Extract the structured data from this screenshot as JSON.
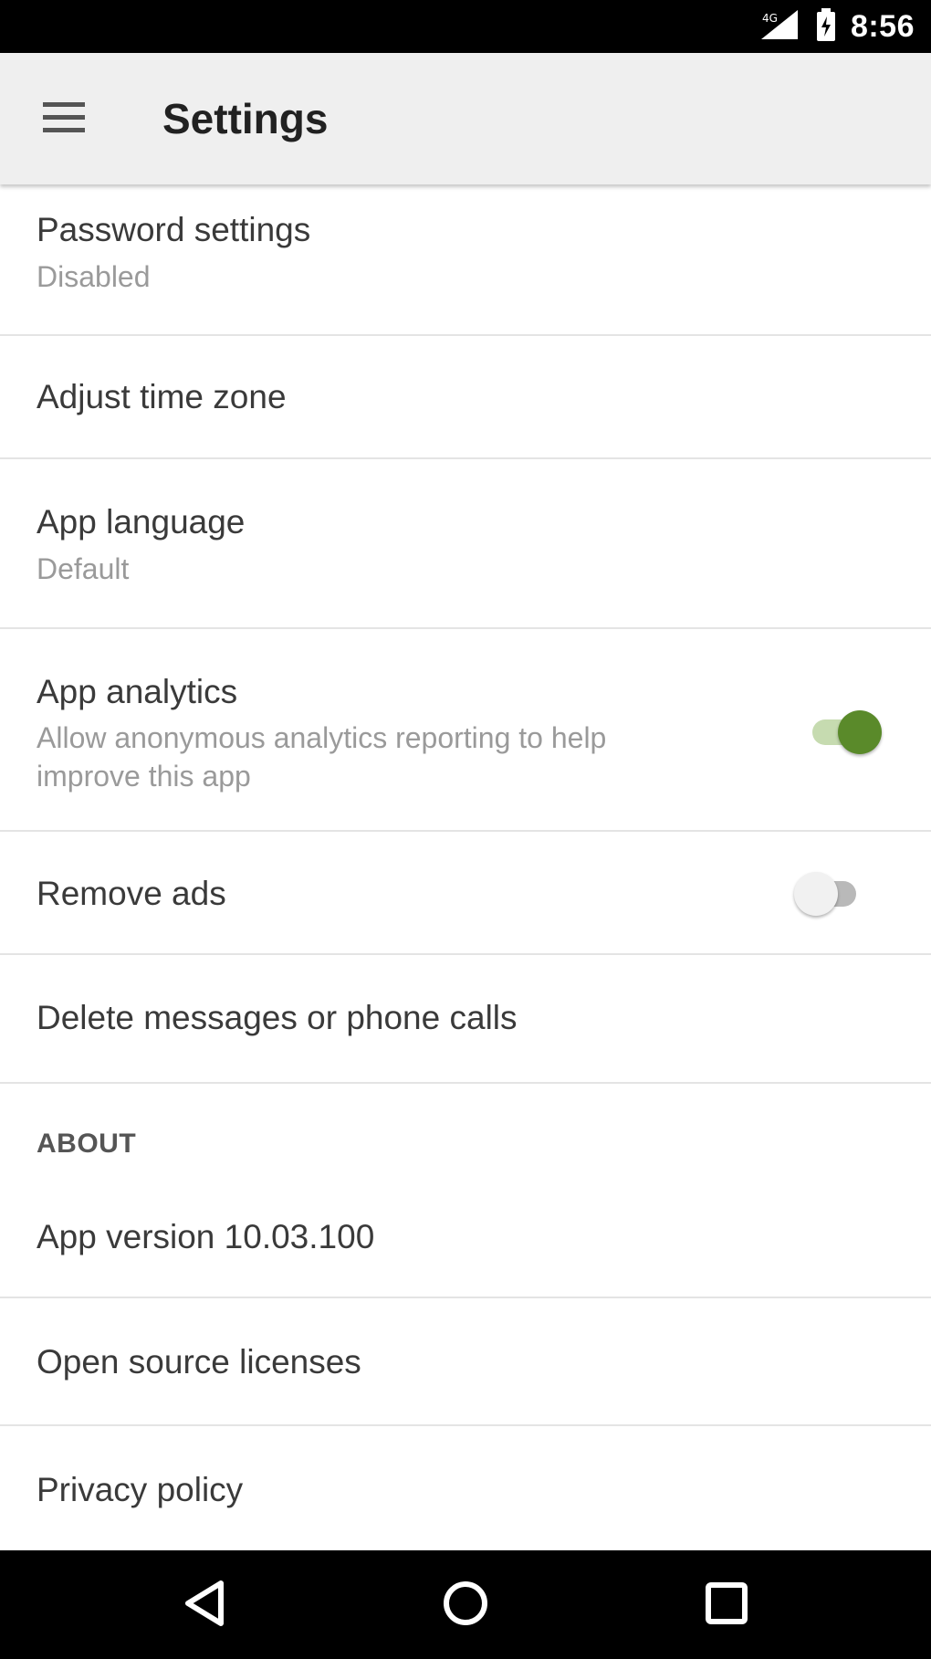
{
  "status_bar": {
    "time": "8:56",
    "icons": [
      "signal-icon",
      "battery-icon"
    ]
  },
  "app_bar": {
    "title": "Settings",
    "menu_icon": "hamburger-menu-icon"
  },
  "settings": {
    "password": {
      "title": "Password settings",
      "subtitle": "Disabled"
    },
    "time_zone": {
      "title": "Adjust time zone"
    },
    "language": {
      "title": "App language",
      "subtitle": "Default"
    },
    "analytics": {
      "title": "App analytics",
      "subtitle_line1": "Allow anonymous analytics reporting to help",
      "subtitle_line2": "improve this app",
      "enabled": true
    },
    "remove_ads": {
      "title": "Remove ads",
      "enabled": false
    },
    "delete": {
      "title": "Delete messages or phone calls"
    }
  },
  "about": {
    "header": "ABOUT",
    "version": "App version 10.03.100",
    "licenses": "Open source licenses",
    "privacy": "Privacy policy"
  },
  "nav_bar": {
    "icons": [
      "back-icon",
      "home-icon",
      "recents-icon"
    ]
  },
  "colors": {
    "accent": "#5a8a2a",
    "accent_track": "#c6dbb0",
    "off_thumb": "#f1f1f1",
    "off_track": "#b9b9b9",
    "app_bar_bg": "#efefef",
    "divider": "#e4e4e4"
  }
}
